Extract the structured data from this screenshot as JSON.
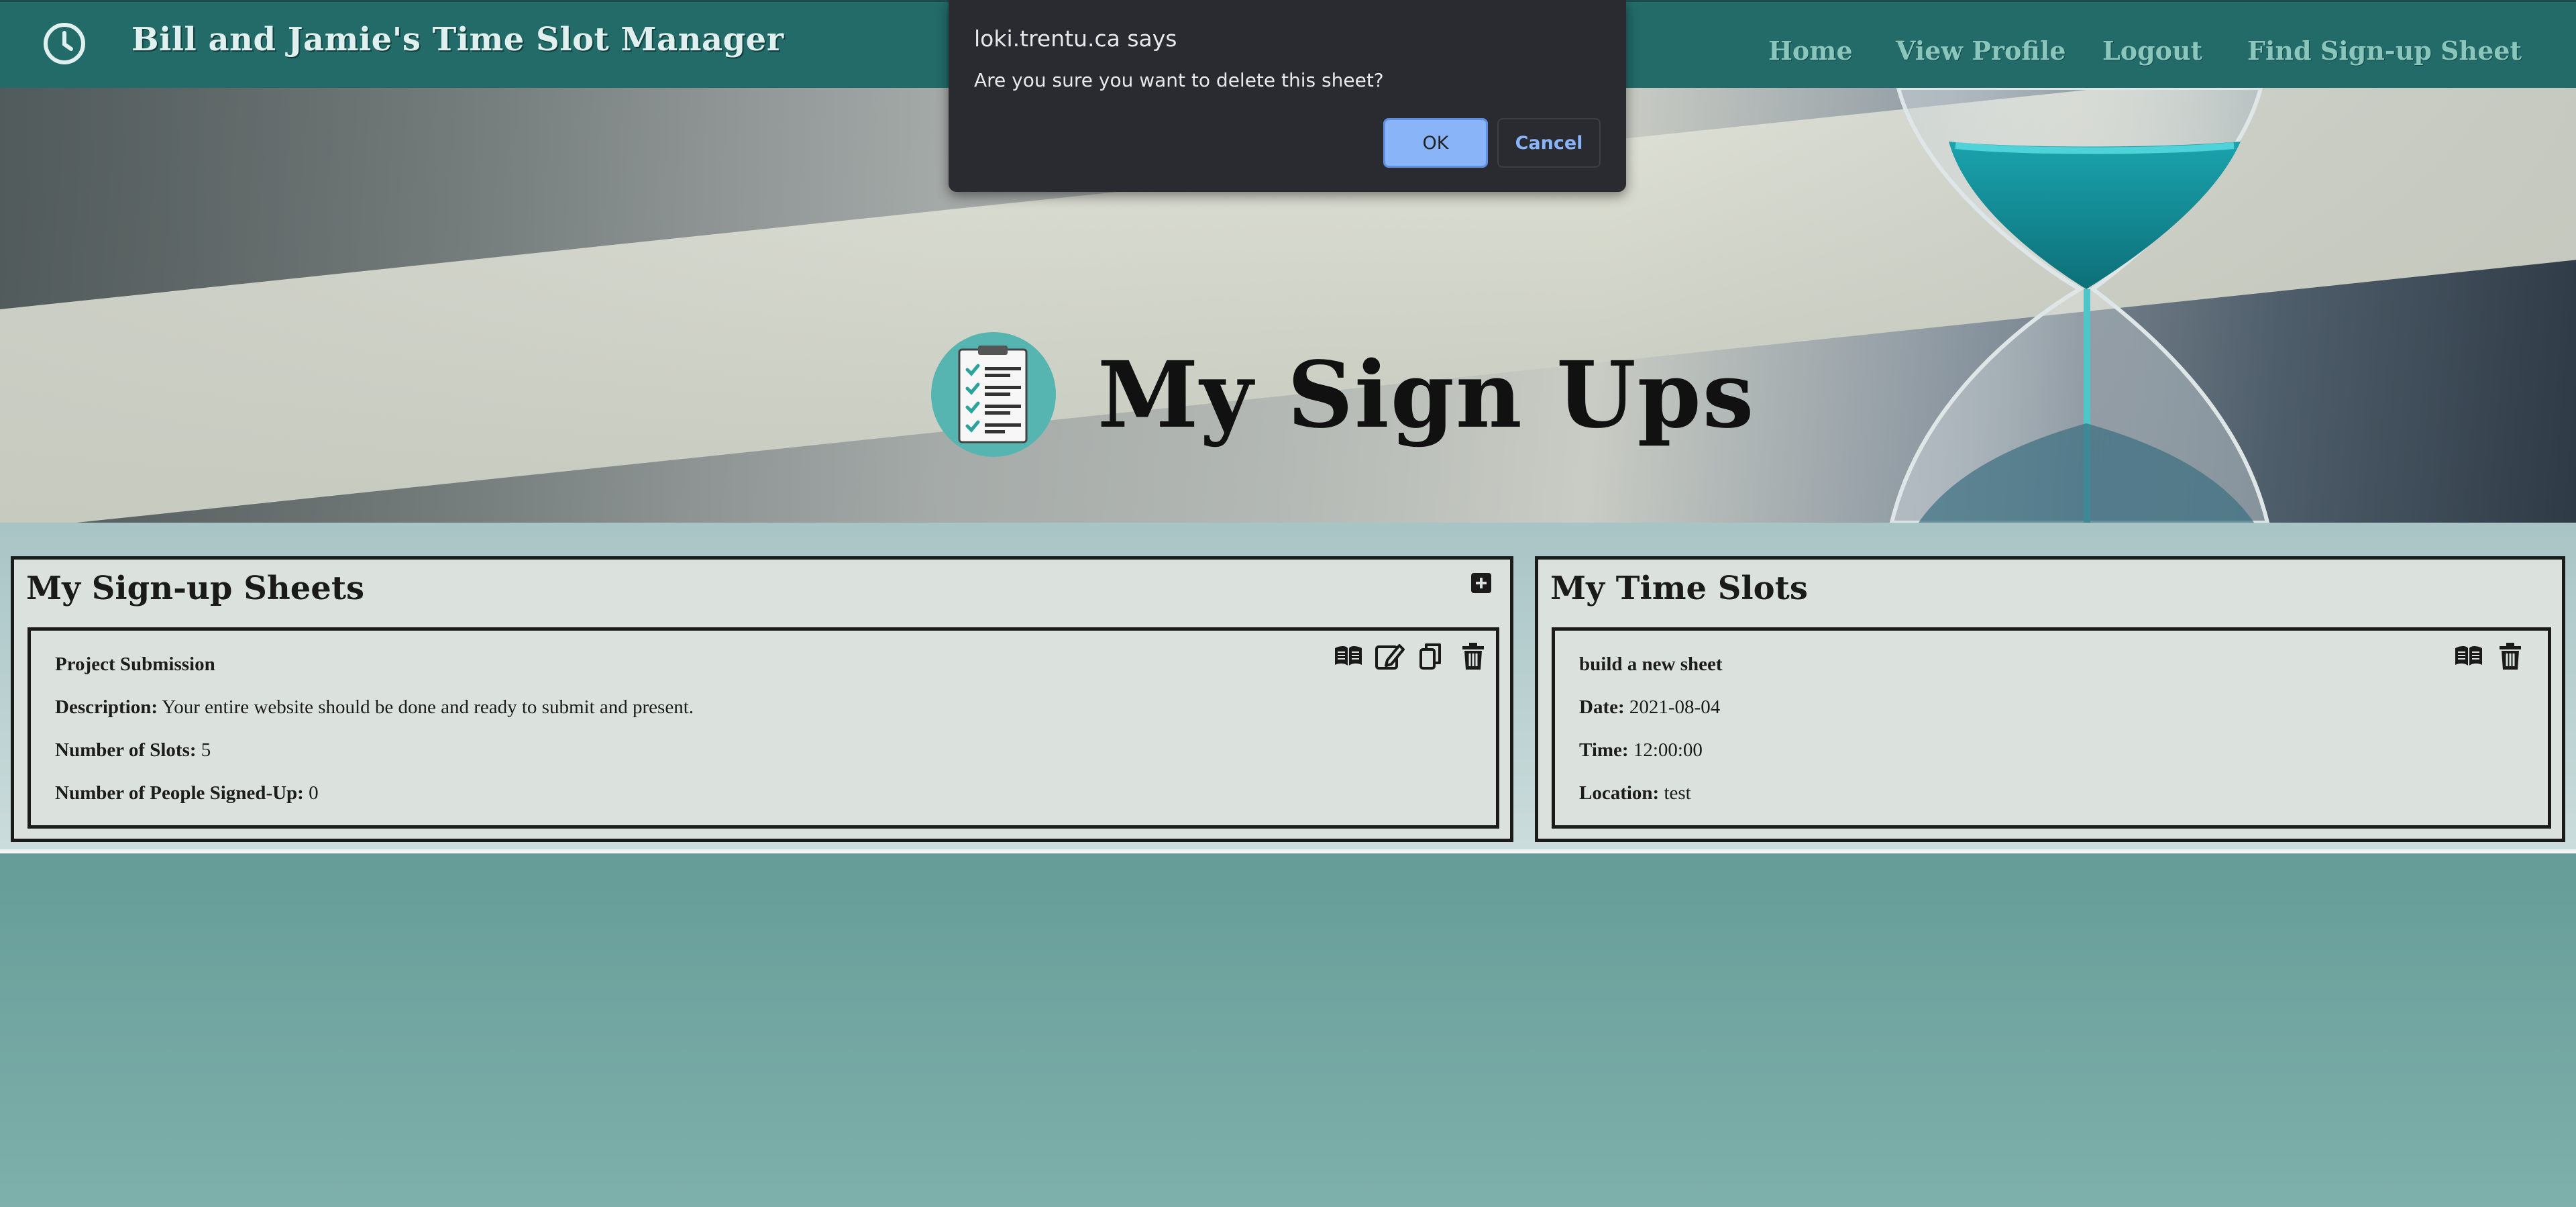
{
  "navbar": {
    "title": "Bill and Jamie's Time Slot Manager",
    "links": [
      "Home",
      "View Profile",
      "Logout",
      "Find Sign-up Sheet"
    ]
  },
  "hero": {
    "title": "My Sign Ups"
  },
  "signup_sheets": {
    "heading": "My Sign-up Sheets",
    "card": {
      "name": "Project Submission",
      "description_label": "Description:",
      "description": "Your entire website should be done and ready to submit and present.",
      "slots_label": "Number of Slots:",
      "slots": "5",
      "signed_label": "Number of People Signed-Up:",
      "signed": "0"
    }
  },
  "time_slots": {
    "heading": "My Time Slots",
    "card": {
      "name": "build a new sheet",
      "date_label": "Date:",
      "date": "2021-08-04",
      "time_label": "Time:",
      "time": "12:00:00",
      "location_label": "Location:",
      "location": "test"
    }
  },
  "dialog": {
    "title": "loki.trentu.ca says",
    "message": "Are you sure you want to delete this sheet?",
    "ok": "OK",
    "cancel": "Cancel"
  },
  "colors": {
    "navbar_bg": "#226b69",
    "nav_link": "#8ac6bb",
    "panel_bg": "#dbe2de",
    "dialog_bg": "#2a2b30",
    "dialog_ok_bg": "#8ab4f8"
  }
}
